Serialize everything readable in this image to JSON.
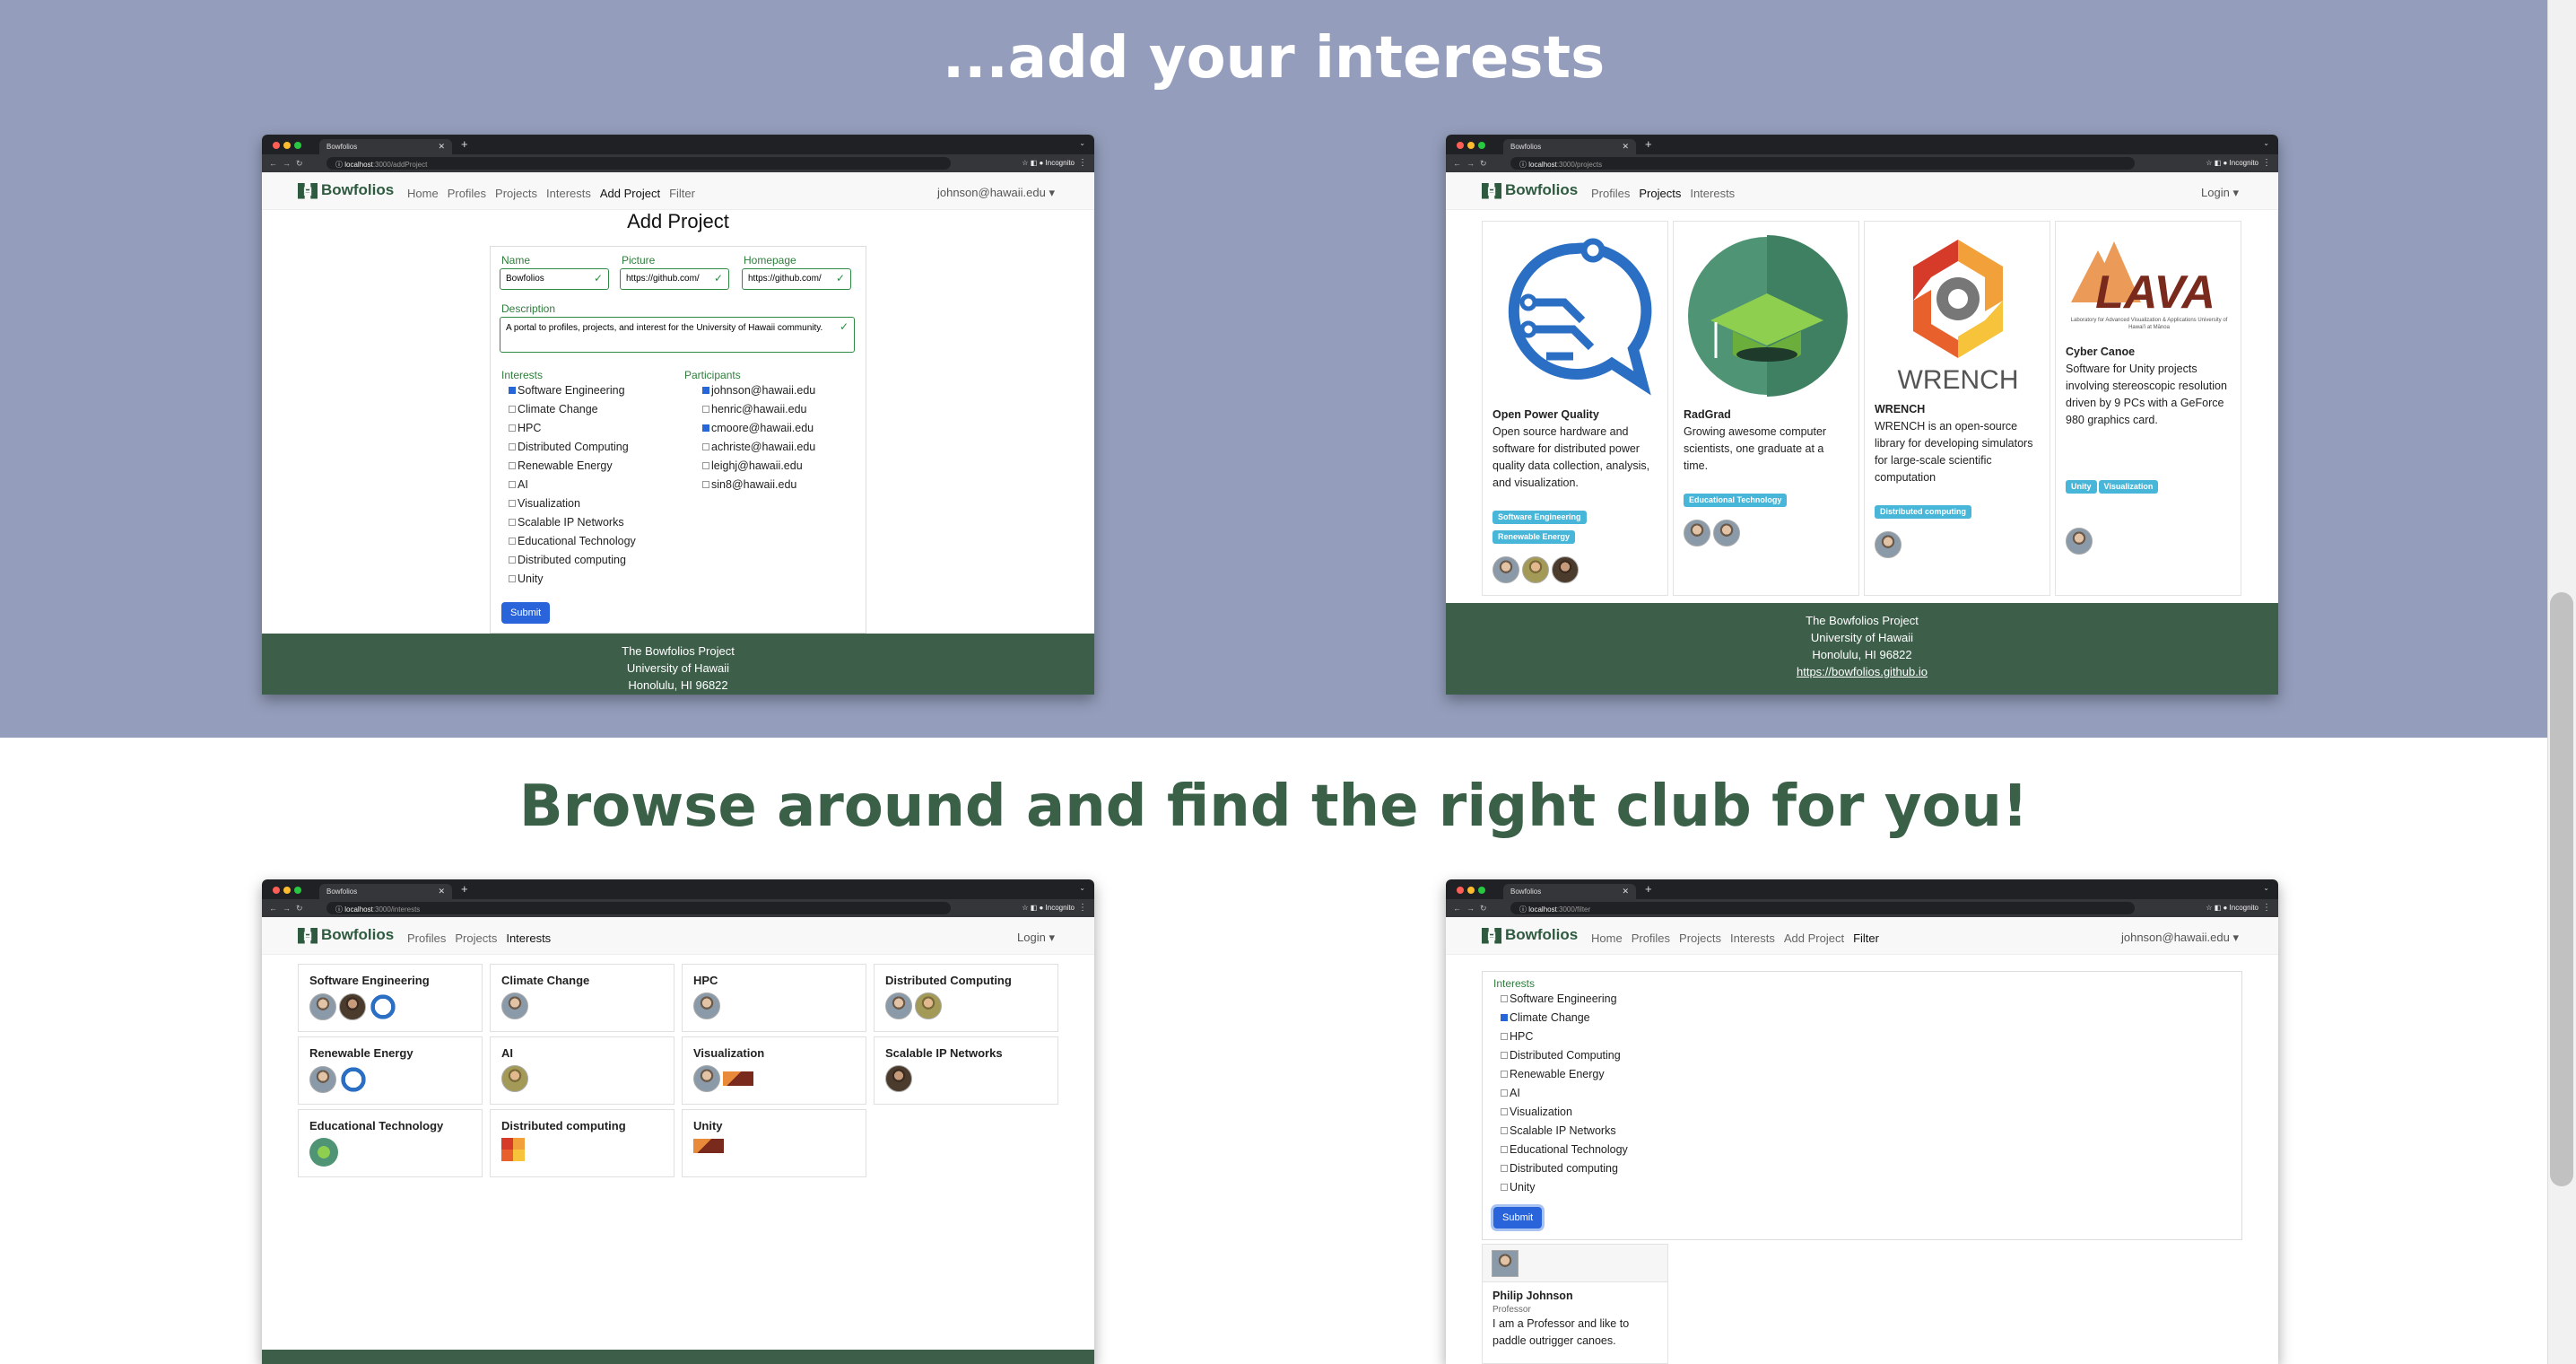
{
  "headings": {
    "top": "...add your interests",
    "middle": "Browse around and find the right club for you!"
  },
  "browser": {
    "tab_title": "Bowfolios",
    "incognito": "Incognito",
    "host": "localhost"
  },
  "screens": {
    "add_project": {
      "url_path": ":3000/addProject",
      "nav": [
        "Home",
        "Profiles",
        "Projects",
        "Interests",
        "Add Project",
        "Filter"
      ],
      "active": "Add Project",
      "user": "johnson@hawaii.edu ▾",
      "title": "Add Project",
      "fields": {
        "name_label": "Name",
        "name_value": "Bowfolios",
        "picture_label": "Picture",
        "picture_value": "https://github.com/",
        "homepage_label": "Homepage",
        "homepage_value": "https://github.com/",
        "description_label": "Description",
        "description_value": "A portal to profiles, projects, and interest for the University of Hawaii community."
      },
      "interests_label": "Interests",
      "participants_label": "Participants",
      "interests": [
        {
          "label": "Software Engineering",
          "checked": true
        },
        {
          "label": "Climate Change",
          "checked": false
        },
        {
          "label": "HPC",
          "checked": false
        },
        {
          "label": "Distributed Computing",
          "checked": false
        },
        {
          "label": "Renewable Energy",
          "checked": false
        },
        {
          "label": "AI",
          "checked": false
        },
        {
          "label": "Visualization",
          "checked": false
        },
        {
          "label": "Scalable IP Networks",
          "checked": false
        },
        {
          "label": "Educational Technology",
          "checked": false
        },
        {
          "label": "Distributed computing",
          "checked": false
        },
        {
          "label": "Unity",
          "checked": false
        }
      ],
      "participants": [
        {
          "label": "johnson@hawaii.edu",
          "checked": true
        },
        {
          "label": "henric@hawaii.edu",
          "checked": false
        },
        {
          "label": "cmoore@hawaii.edu",
          "checked": true
        },
        {
          "label": "achriste@hawaii.edu",
          "checked": false
        },
        {
          "label": "leighj@hawaii.edu",
          "checked": false
        },
        {
          "label": "sin8@hawaii.edu",
          "checked": false
        }
      ],
      "submit": "Submit",
      "footer": [
        "The Bowfolios Project",
        "University of Hawaii",
        "Honolulu, HI 96822"
      ]
    },
    "projects": {
      "url_path": ":3000/projects",
      "nav": [
        "Profiles",
        "Projects",
        "Interests"
      ],
      "active": "Projects",
      "login": "Login ▾",
      "cards": [
        {
          "title": "Open Power Quality",
          "desc": "Open source hardware and software for distributed power quality data collection, analysis, and visualization.",
          "badges": [
            "Software Engineering",
            "Renewable Energy"
          ]
        },
        {
          "title": "RadGrad",
          "desc": "Growing awesome computer scientists, one graduate at a time.",
          "badges": [
            "Educational Technology"
          ]
        },
        {
          "title": "WRENCH",
          "desc": "WRENCH is an open-source library for developing simulators for large-scale scientific computation",
          "badges": [
            "Distributed computing"
          ],
          "logo_text": "WRENCH"
        },
        {
          "title": "Cyber Canoe",
          "desc": "Software for Unity projects involving stereoscopic resolution driven by 9 PCs with a GeForce 980 graphics card.",
          "badges": [
            "Unity",
            "Visualization"
          ],
          "logo_text": "LAVA",
          "logo_sub": "Laboratory for Advanced Visualization & Applications University of Hawai'i at Mānoa"
        }
      ],
      "footer": [
        "The Bowfolios Project",
        "University of Hawaii",
        "Honolulu, HI 96822",
        "https://bowfolios.github.io"
      ]
    },
    "interests": {
      "url_path": ":3000/interests",
      "nav": [
        "Profiles",
        "Projects",
        "Interests"
      ],
      "active": "Interests",
      "login": "Login ▾",
      "cards": [
        "Software Engineering",
        "Climate Change",
        "HPC",
        "Distributed Computing",
        "Renewable Energy",
        "AI",
        "Visualization",
        "Scalable IP Networks",
        "Educational Technology",
        "Distributed computing",
        "Unity"
      ]
    },
    "filter": {
      "url_path": ":3000/filter",
      "nav": [
        "Home",
        "Profiles",
        "Projects",
        "Interests",
        "Add Project",
        "Filter"
      ],
      "active": "Filter",
      "user": "johnson@hawaii.edu ▾",
      "interests_label": "Interests",
      "interests": [
        {
          "label": "Software Engineering",
          "checked": false
        },
        {
          "label": "Climate Change",
          "checked": true
        },
        {
          "label": "HPC",
          "checked": false
        },
        {
          "label": "Distributed Computing",
          "checked": false
        },
        {
          "label": "Renewable Energy",
          "checked": false
        },
        {
          "label": "AI",
          "checked": false
        },
        {
          "label": "Visualization",
          "checked": false
        },
        {
          "label": "Scalable IP Networks",
          "checked": false
        },
        {
          "label": "Educational Technology",
          "checked": false
        },
        {
          "label": "Distributed computing",
          "checked": false
        },
        {
          "label": "Unity",
          "checked": false
        }
      ],
      "submit": "Submit",
      "profile": {
        "name": "Philip Johnson",
        "title": "Professor",
        "bio": "I am a Professor and like to paddle outrigger canoes."
      }
    }
  },
  "colors": {
    "band": "#949ebc",
    "brand_green": "#3d5f4a",
    "badge": "#48b6d8",
    "submit": "#2a64db"
  }
}
